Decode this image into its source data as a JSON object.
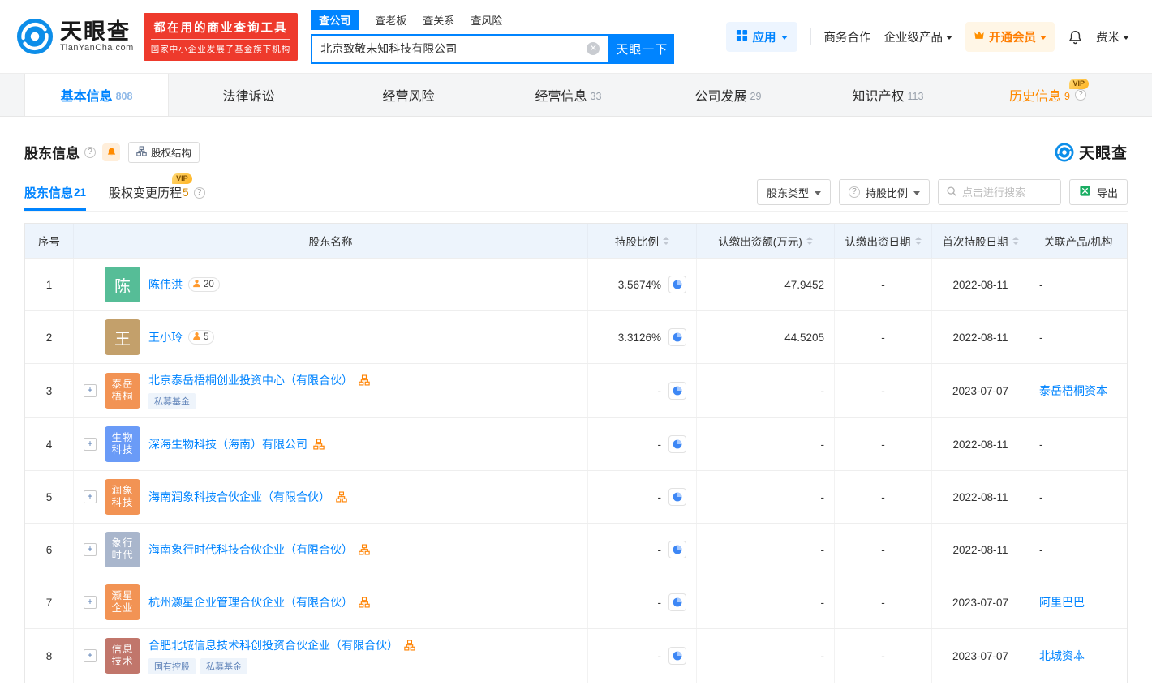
{
  "brand": {
    "name": "天眼查",
    "domain": "TianYanCha.com",
    "colors": {
      "blue": "#0084ff",
      "orange": "#ff8a00",
      "red": "#ee3a2c",
      "link": "#0084ff"
    }
  },
  "header": {
    "banner_line1": "都在用的商业查询工具",
    "banner_line2": "国家中小企业发展子基金旗下机构",
    "search_tabs": [
      {
        "key": "company",
        "label": "查公司",
        "active": true
      },
      {
        "key": "boss",
        "label": "查老板",
        "active": false
      },
      {
        "key": "relation",
        "label": "查关系",
        "active": false
      },
      {
        "key": "risk",
        "label": "查风险",
        "active": false
      }
    ],
    "search_value": "北京致敬未知科技有限公司",
    "search_button": "天眼一下",
    "apps_label": "应用",
    "nav_items": [
      "商务合作",
      "企业级产品"
    ],
    "vip_label": "开通会员",
    "username": "费米"
  },
  "main_tabs": [
    {
      "key": "basic-info",
      "label": "基本信息",
      "count": "808",
      "active": true,
      "vip": false,
      "help": false
    },
    {
      "key": "legal",
      "label": "法律诉讼",
      "count": "",
      "active": false,
      "vip": false,
      "help": false
    },
    {
      "key": "operation-risk",
      "label": "经营风险",
      "count": "",
      "active": false,
      "vip": false,
      "help": false
    },
    {
      "key": "operation-info",
      "label": "经营信息",
      "count": "33",
      "active": false,
      "vip": false,
      "help": false
    },
    {
      "key": "development",
      "label": "公司发展",
      "count": "29",
      "active": false,
      "vip": false,
      "help": false
    },
    {
      "key": "ip",
      "label": "知识产权",
      "count": "113",
      "active": false,
      "vip": false,
      "help": false
    },
    {
      "key": "history",
      "label": "历史信息",
      "count": "9",
      "active": false,
      "vip": true,
      "help": true
    }
  ],
  "section": {
    "title": "股东信息",
    "equity_structure_label": "股权结构",
    "watermark": "天眼查",
    "subtabs": [
      {
        "key": "shareholders",
        "label": "股东信息",
        "count": "21",
        "active": true,
        "vip": false,
        "help": false
      },
      {
        "key": "equity-changes",
        "label": "股权变更历程",
        "count": "5",
        "active": false,
        "vip": true,
        "help": true
      }
    ],
    "filter_type_label": "股东类型",
    "filter_ratio_label": "持股比例",
    "search_placeholder": "点击进行搜索",
    "export_label": "导出"
  },
  "table": {
    "columns": [
      {
        "label": "序号",
        "sortable": false
      },
      {
        "label": "股东名称",
        "sortable": false
      },
      {
        "label": "持股比例",
        "sortable": true
      },
      {
        "label": "认缴出资额(万元)",
        "sortable": true
      },
      {
        "label": "认缴出资日期",
        "sortable": true
      },
      {
        "label": "首次持股日期",
        "sortable": true
      },
      {
        "label": "关联产品/机构",
        "sortable": false
      }
    ],
    "rows": [
      {
        "index": "1",
        "type": "person",
        "avatar_text": "陈",
        "avatar_color": "#56bd97",
        "name": "陈伟洪",
        "partner_count": "20",
        "tags": [],
        "ratio": "3.5674%",
        "amount": "47.9452",
        "pay_date": "-",
        "first_date": "2022-08-11",
        "related": "-",
        "related_is_link": false
      },
      {
        "index": "2",
        "type": "person",
        "avatar_text": "王",
        "avatar_color": "#c3a06b",
        "name": "王小玲",
        "partner_count": "5",
        "tags": [],
        "ratio": "3.3126%",
        "amount": "44.5205",
        "pay_date": "-",
        "first_date": "2022-08-11",
        "related": "-",
        "related_is_link": false
      },
      {
        "index": "3",
        "type": "company",
        "avatar_line1": "泰岳",
        "avatar_line2": "梧桐",
        "avatar_color": "#f29354",
        "name": "北京泰岳梧桐创业投资中心（有限合伙）",
        "tags": [
          "私募基金"
        ],
        "ratio": "-",
        "amount": "-",
        "pay_date": "-",
        "first_date": "2023-07-07",
        "related": "泰岳梧桐资本",
        "related_is_link": true
      },
      {
        "index": "4",
        "type": "company",
        "avatar_line1": "生物",
        "avatar_line2": "科技",
        "avatar_color": "#6a9bf7",
        "name": "深海生物科技（海南）有限公司",
        "tags": [],
        "ratio": "-",
        "amount": "-",
        "pay_date": "-",
        "first_date": "2022-08-11",
        "related": "-",
        "related_is_link": false
      },
      {
        "index": "5",
        "type": "company",
        "avatar_line1": "润象",
        "avatar_line2": "科技",
        "avatar_color": "#f29354",
        "name": "海南润象科技合伙企业（有限合伙）",
        "tags": [],
        "ratio": "-",
        "amount": "-",
        "pay_date": "-",
        "first_date": "2022-08-11",
        "related": "-",
        "related_is_link": false
      },
      {
        "index": "6",
        "type": "company",
        "avatar_line1": "象行",
        "avatar_line2": "时代",
        "avatar_color": "#a9b6cc",
        "name": "海南象行时代科技合伙企业（有限合伙）",
        "tags": [],
        "ratio": "-",
        "amount": "-",
        "pay_date": "-",
        "first_date": "2022-08-11",
        "related": "-",
        "related_is_link": false
      },
      {
        "index": "7",
        "type": "company",
        "avatar_line1": "灏星",
        "avatar_line2": "企业",
        "avatar_color": "#f29354",
        "name": "杭州灏星企业管理合伙企业（有限合伙）",
        "tags": [],
        "ratio": "-",
        "amount": "-",
        "pay_date": "-",
        "first_date": "2023-07-07",
        "related": "阿里巴巴",
        "related_is_link": true
      },
      {
        "index": "8",
        "type": "company",
        "avatar_line1": "信息",
        "avatar_line2": "技术",
        "avatar_color": "#c1766b",
        "name": "合肥北城信息技术科创投资合伙企业（有限合伙）",
        "tags": [
          "国有控股",
          "私募基金"
        ],
        "ratio": "-",
        "amount": "-",
        "pay_date": "-",
        "first_date": "2023-07-07",
        "related": "北城资本",
        "related_is_link": true
      }
    ]
  }
}
